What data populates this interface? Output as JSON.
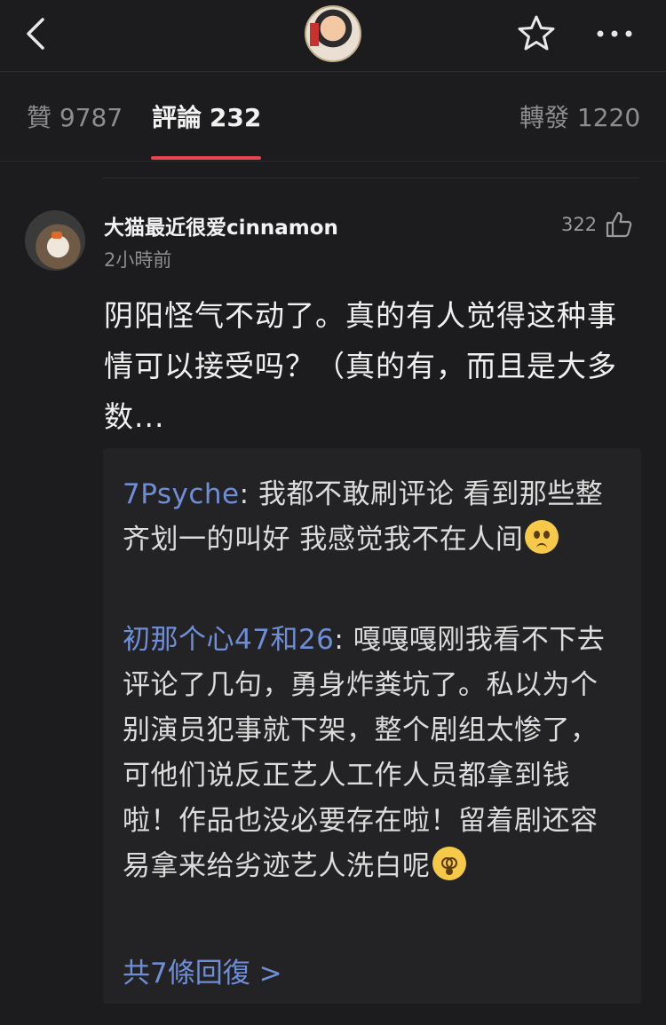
{
  "nav": {
    "back_icon": "chevron-left-icon",
    "star_icon": "star-outline-icon",
    "more_icon": "more-horizontal-icon"
  },
  "tabs": {
    "likes": {
      "label": "贊",
      "count": "9787"
    },
    "comments": {
      "label": "評論",
      "count": "232"
    },
    "reposts": {
      "label": "轉發",
      "count": "1220"
    }
  },
  "comment": {
    "username": "大猫最近很爱cinnamon",
    "time": "2小時前",
    "likes": "322",
    "text": "阴阳怪气不动了。真的有人觉得这种事情可以接受吗？（真的有，而且是大多数..."
  },
  "replies": [
    {
      "name": "7Psyche",
      "text": "我都不敢刷评论 看到那些整齐划一的叫好 我感觉我不在人间"
    },
    {
      "name": "初那个心47和26",
      "text": "嘎嘎嘎刚我看不下去评论了几句，勇身炸粪坑了。私以为个别演员犯事就下架，整个剧组太惨了，可他们说反正艺人工作人员都拿到钱啦！作品也没必要存在啦！留着剧还容易拿来给劣迹艺人洗白呢"
    }
  ],
  "more_replies": "共7條回復 >",
  "colors": {
    "background": "#1c1c1e",
    "accent_underline": "#e5464f",
    "link_blue": "#6f8ed6"
  }
}
